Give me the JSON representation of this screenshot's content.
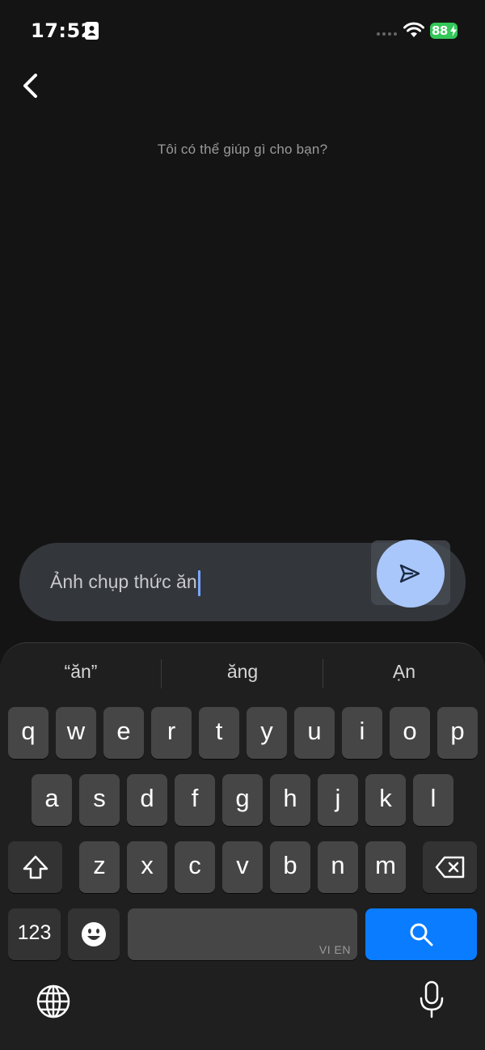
{
  "status_bar": {
    "time": "17:52",
    "battery": "88"
  },
  "screen": {
    "prompt": "Tôi có thể giúp gì cho bạn?"
  },
  "input": {
    "value": "Ảnh chụp thức ăn"
  },
  "keyboard": {
    "suggestions": [
      "“ăn”",
      "ăng",
      "Ạn"
    ],
    "row1": [
      "q",
      "w",
      "e",
      "r",
      "t",
      "y",
      "u",
      "i",
      "o",
      "p"
    ],
    "row2": [
      "a",
      "s",
      "d",
      "f",
      "g",
      "h",
      "j",
      "k",
      "l"
    ],
    "row3": [
      "z",
      "x",
      "c",
      "v",
      "b",
      "n",
      "m"
    ],
    "numbers_label": "123",
    "space_hint": "VI EN",
    "search_color": "#0a7cff"
  },
  "colors": {
    "background": "#141414",
    "send_button": "#a9c7fb",
    "battery": "#34c759"
  }
}
